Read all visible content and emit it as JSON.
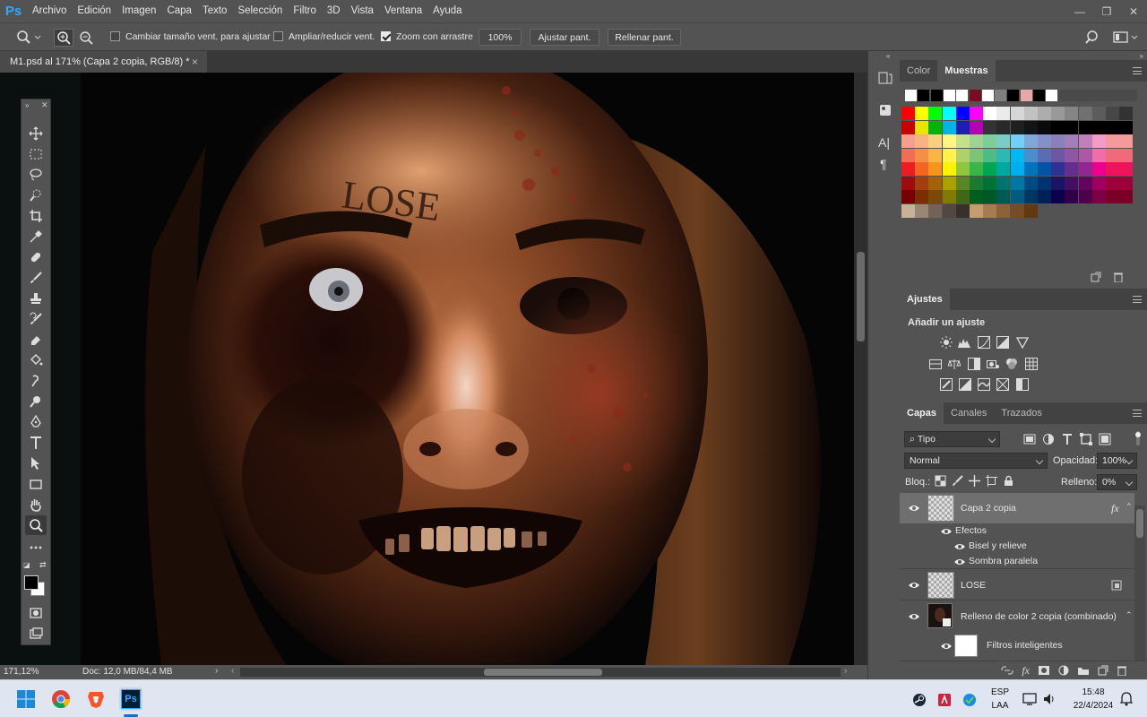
{
  "app": {
    "logo": "Ps",
    "name": "Adobe Photoshop"
  },
  "menu": [
    "Archivo",
    "Edición",
    "Imagen",
    "Capa",
    "Texto",
    "Selección",
    "Filtro",
    "3D",
    "Vista",
    "Ventana",
    "Ayuda"
  ],
  "options": {
    "resize_windows": {
      "label": "Cambiar tamaño vent. para ajustar",
      "checked": false
    },
    "zoom_all": {
      "label": "Ampliar/reducir vent.",
      "checked": false
    },
    "scrubby_zoom": {
      "label": "Zoom con arrastre",
      "checked": true
    },
    "zoom_100": "100%",
    "fit_screen": "Ajustar pant.",
    "fill_screen": "Rellenar pant."
  },
  "document": {
    "tab_title": "M1.psd al 171% (Capa 2 copia, RGB/8) *",
    "close_glyph": "×",
    "forehead_text": "LOSE"
  },
  "status": {
    "zoom": "171,12%",
    "doc": "Doc: 12,0 MB/84,4 MB"
  },
  "color_panel": {
    "tabs": [
      "Color",
      "Muestras"
    ],
    "active_tab": "Muestras",
    "recent": [
      "#ffffff",
      "#000000",
      "#000000",
      "#ffffff",
      "#ffffff",
      "#7a0b22",
      "#ffffff",
      "#7f7f7f",
      "#000000",
      "#e8a8a8",
      "#000000",
      "#ffffff"
    ],
    "grid": [
      [
        "#ff0000",
        "#ffff00",
        "#00ff00",
        "#00ffff",
        "#0000ff",
        "#ff00ff",
        "#ffffff",
        "#ebebeb",
        "#d6d6d6",
        "#c2c2c2",
        "#adadad",
        "#999999",
        "#858585",
        "#707070",
        "#5c5c5c",
        "#474747",
        "#333333"
      ],
      [
        "#c80000",
        "#e6e600",
        "#00b400",
        "#00b4e6",
        "#1e1eb4",
        "#b400b4",
        "#333333",
        "#292929",
        "#1f1f1f",
        "#141414",
        "#0a0a0a",
        "#000000",
        "#000000",
        "#000000",
        "#000000",
        "#000000",
        "#000000"
      ],
      [
        "#f5a08c",
        "#f7b480",
        "#fbd07c",
        "#fff582",
        "#c5e08a",
        "#9fd391",
        "#81cd99",
        "#7accc8",
        "#74cef5",
        "#7fa8d8",
        "#8490c8",
        "#8c7fba",
        "#a27fba",
        "#c080b9",
        "#f29ac8",
        "#f39a9a",
        "#f39a9a"
      ],
      [
        "#f06e54",
        "#f58f47",
        "#fbb542",
        "#fff24d",
        "#acd36b",
        "#7ec474",
        "#4ebc85",
        "#2bb9b2",
        "#00b7ef",
        "#4d8ccd",
        "#5a6cb3",
        "#6d57a5",
        "#8e56a5",
        "#ac59a5",
        "#ef6ea8",
        "#f06b7a",
        "#f06b7a"
      ],
      [
        "#ed1c24",
        "#f26522",
        "#f7941d",
        "#fff200",
        "#8dc63f",
        "#39b54a",
        "#00a651",
        "#00a99d",
        "#00aeef",
        "#0072bc",
        "#0054a6",
        "#2e3192",
        "#662d91",
        "#92278f",
        "#ec008c",
        "#ed145b",
        "#ed145b"
      ],
      [
        "#9e0b0f",
        "#a0410d",
        "#a3620a",
        "#aba000",
        "#598527",
        "#197b30",
        "#007236",
        "#00746b",
        "#0076a3",
        "#004a80",
        "#003471",
        "#1b1464",
        "#440e62",
        "#630460",
        "#9e005d",
        "#9e0039",
        "#9e0039"
      ],
      [
        "#790000",
        "#7b2e00",
        "#7d4900",
        "#827b00",
        "#406618",
        "#005e20",
        "#005826",
        "#005952",
        "#005b7f",
        "#003663",
        "#002157",
        "#0d004c",
        "#32004b",
        "#4b0049",
        "#7b0046",
        "#7a0026",
        "#7a0026"
      ],
      [
        "#c7b299",
        "#998675",
        "#736357",
        "#534741",
        "#37302d",
        "#c69c6d",
        "#a67c52",
        "#8c6239",
        "#754c24",
        "#603913"
      ]
    ]
  },
  "adjustments": {
    "tab": "Ajustes",
    "heading": "Añadir un ajuste"
  },
  "layers_panel": {
    "tabs": [
      "Capas",
      "Canales",
      "Trazados"
    ],
    "filter": "Tipo",
    "blend_mode": "Normal",
    "opacity_label": "Opacidad:",
    "opacity": "100%",
    "lock_label": "Bloq.:",
    "fill_label": "Relleno:",
    "fill": "0%",
    "layers": [
      {
        "name": "Capa 2 copia",
        "selected": true,
        "fx": "fx"
      },
      {
        "name": "Efectos"
      },
      {
        "name": "Bisel y relieve"
      },
      {
        "name": "Sombra paralela"
      },
      {
        "name": "LOSE"
      },
      {
        "name": "Relleno de color 2 copia (combinado)"
      },
      {
        "name": "Filtros inteligentes"
      }
    ]
  },
  "taskbar": {
    "lang": "ESP",
    "layout": "LAA",
    "time": "15:48",
    "date": "22/4/2024",
    "ps_label": "Ps"
  }
}
